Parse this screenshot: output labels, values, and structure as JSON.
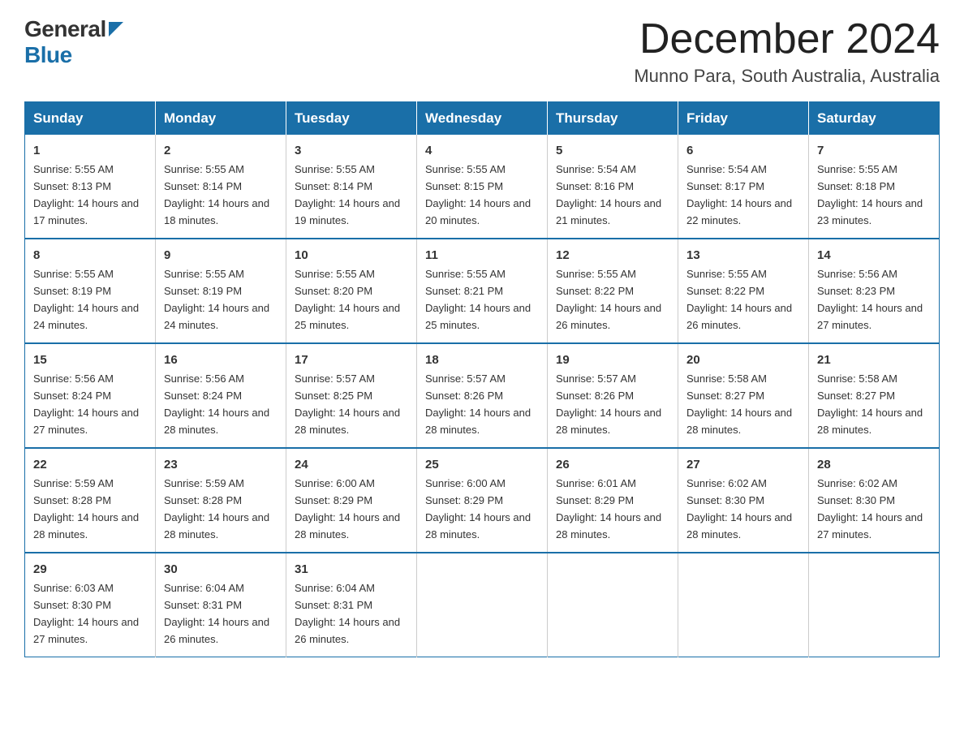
{
  "header": {
    "logo_general": "General",
    "logo_blue": "Blue",
    "title": "December 2024",
    "location": "Munno Para, South Australia, Australia"
  },
  "calendar": {
    "weekdays": [
      "Sunday",
      "Monday",
      "Tuesday",
      "Wednesday",
      "Thursday",
      "Friday",
      "Saturday"
    ],
    "weeks": [
      [
        {
          "day": "1",
          "sunrise": "5:55 AM",
          "sunset": "8:13 PM",
          "daylight": "14 hours and 17 minutes."
        },
        {
          "day": "2",
          "sunrise": "5:55 AM",
          "sunset": "8:14 PM",
          "daylight": "14 hours and 18 minutes."
        },
        {
          "day": "3",
          "sunrise": "5:55 AM",
          "sunset": "8:14 PM",
          "daylight": "14 hours and 19 minutes."
        },
        {
          "day": "4",
          "sunrise": "5:55 AM",
          "sunset": "8:15 PM",
          "daylight": "14 hours and 20 minutes."
        },
        {
          "day": "5",
          "sunrise": "5:54 AM",
          "sunset": "8:16 PM",
          "daylight": "14 hours and 21 minutes."
        },
        {
          "day": "6",
          "sunrise": "5:54 AM",
          "sunset": "8:17 PM",
          "daylight": "14 hours and 22 minutes."
        },
        {
          "day": "7",
          "sunrise": "5:55 AM",
          "sunset": "8:18 PM",
          "daylight": "14 hours and 23 minutes."
        }
      ],
      [
        {
          "day": "8",
          "sunrise": "5:55 AM",
          "sunset": "8:19 PM",
          "daylight": "14 hours and 24 minutes."
        },
        {
          "day": "9",
          "sunrise": "5:55 AM",
          "sunset": "8:19 PM",
          "daylight": "14 hours and 24 minutes."
        },
        {
          "day": "10",
          "sunrise": "5:55 AM",
          "sunset": "8:20 PM",
          "daylight": "14 hours and 25 minutes."
        },
        {
          "day": "11",
          "sunrise": "5:55 AM",
          "sunset": "8:21 PM",
          "daylight": "14 hours and 25 minutes."
        },
        {
          "day": "12",
          "sunrise": "5:55 AM",
          "sunset": "8:22 PM",
          "daylight": "14 hours and 26 minutes."
        },
        {
          "day": "13",
          "sunrise": "5:55 AM",
          "sunset": "8:22 PM",
          "daylight": "14 hours and 26 minutes."
        },
        {
          "day": "14",
          "sunrise": "5:56 AM",
          "sunset": "8:23 PM",
          "daylight": "14 hours and 27 minutes."
        }
      ],
      [
        {
          "day": "15",
          "sunrise": "5:56 AM",
          "sunset": "8:24 PM",
          "daylight": "14 hours and 27 minutes."
        },
        {
          "day": "16",
          "sunrise": "5:56 AM",
          "sunset": "8:24 PM",
          "daylight": "14 hours and 28 minutes."
        },
        {
          "day": "17",
          "sunrise": "5:57 AM",
          "sunset": "8:25 PM",
          "daylight": "14 hours and 28 minutes."
        },
        {
          "day": "18",
          "sunrise": "5:57 AM",
          "sunset": "8:26 PM",
          "daylight": "14 hours and 28 minutes."
        },
        {
          "day": "19",
          "sunrise": "5:57 AM",
          "sunset": "8:26 PM",
          "daylight": "14 hours and 28 minutes."
        },
        {
          "day": "20",
          "sunrise": "5:58 AM",
          "sunset": "8:27 PM",
          "daylight": "14 hours and 28 minutes."
        },
        {
          "day": "21",
          "sunrise": "5:58 AM",
          "sunset": "8:27 PM",
          "daylight": "14 hours and 28 minutes."
        }
      ],
      [
        {
          "day": "22",
          "sunrise": "5:59 AM",
          "sunset": "8:28 PM",
          "daylight": "14 hours and 28 minutes."
        },
        {
          "day": "23",
          "sunrise": "5:59 AM",
          "sunset": "8:28 PM",
          "daylight": "14 hours and 28 minutes."
        },
        {
          "day": "24",
          "sunrise": "6:00 AM",
          "sunset": "8:29 PM",
          "daylight": "14 hours and 28 minutes."
        },
        {
          "day": "25",
          "sunrise": "6:00 AM",
          "sunset": "8:29 PM",
          "daylight": "14 hours and 28 minutes."
        },
        {
          "day": "26",
          "sunrise": "6:01 AM",
          "sunset": "8:29 PM",
          "daylight": "14 hours and 28 minutes."
        },
        {
          "day": "27",
          "sunrise": "6:02 AM",
          "sunset": "8:30 PM",
          "daylight": "14 hours and 28 minutes."
        },
        {
          "day": "28",
          "sunrise": "6:02 AM",
          "sunset": "8:30 PM",
          "daylight": "14 hours and 27 minutes."
        }
      ],
      [
        {
          "day": "29",
          "sunrise": "6:03 AM",
          "sunset": "8:30 PM",
          "daylight": "14 hours and 27 minutes."
        },
        {
          "day": "30",
          "sunrise": "6:04 AM",
          "sunset": "8:31 PM",
          "daylight": "14 hours and 26 minutes."
        },
        {
          "day": "31",
          "sunrise": "6:04 AM",
          "sunset": "8:31 PM",
          "daylight": "14 hours and 26 minutes."
        },
        null,
        null,
        null,
        null
      ]
    ]
  }
}
